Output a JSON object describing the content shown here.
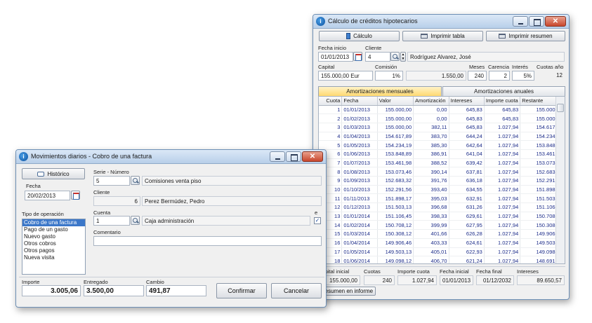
{
  "creditos": {
    "title": "Cálculo de créditos hipotecarios",
    "toolbar": {
      "calculo": "Cálculo",
      "imprimir_tabla": "Imprimir tabla",
      "imprimir_resumen": "Imprimir resumen"
    },
    "fecha_inicio": {
      "label": "Fecha inicio",
      "value": "01/01/2013"
    },
    "cliente": {
      "label": "Cliente",
      "code": "4",
      "name": "Rodríguez Alvarez, José"
    },
    "capital": {
      "label": "Capital",
      "value": "155.000,00 Eur"
    },
    "comision": {
      "label": "Comisión",
      "value": "1%",
      "amount": "1.550,00"
    },
    "meses": {
      "label": "Meses",
      "value": "240"
    },
    "carencia": {
      "label": "Carencia",
      "value": "2"
    },
    "interes": {
      "label": "Interés",
      "value": "5%"
    },
    "cuotas_anio": {
      "label": "Cuotas año",
      "value": "12"
    },
    "tabs": {
      "mensuales": "Amortizaciones mensuales",
      "anuales": "Amortizaciones anuales"
    },
    "table": {
      "headers": [
        "Cuota",
        "Fecha",
        "Valor",
        "Amortización",
        "Intereses",
        "Importe cuota",
        "Restante"
      ],
      "rows": [
        [
          "1",
          "01/01/2013",
          "155.000,00",
          "0,00",
          "645,83",
          "645,83",
          "155.000,00"
        ],
        [
          "2",
          "01/02/2013",
          "155.000,00",
          "0,00",
          "645,83",
          "645,83",
          "155.000,00"
        ],
        [
          "3",
          "01/03/2013",
          "155.000,00",
          "382,11",
          "645,83",
          "1.027,94",
          "154.617,89"
        ],
        [
          "4",
          "01/04/2013",
          "154.617,89",
          "383,70",
          "644,24",
          "1.027,94",
          "154.234,19"
        ],
        [
          "5",
          "01/05/2013",
          "154.234,19",
          "385,30",
          "642,64",
          "1.027,94",
          "153.848,89"
        ],
        [
          "6",
          "01/06/2013",
          "153.848,89",
          "386,91",
          "641,04",
          "1.027,94",
          "153.461,98"
        ],
        [
          "7",
          "01/07/2013",
          "153.461,98",
          "388,52",
          "639,42",
          "1.027,94",
          "153.073,46"
        ],
        [
          "8",
          "01/08/2013",
          "153.073,46",
          "390,14",
          "637,81",
          "1.027,94",
          "152.683,32"
        ],
        [
          "9",
          "01/09/2013",
          "152.683,32",
          "391,76",
          "636,18",
          "1.027,94",
          "152.291,56"
        ],
        [
          "10",
          "01/10/2013",
          "152.291,56",
          "393,40",
          "634,55",
          "1.027,94",
          "151.898,17"
        ],
        [
          "11",
          "01/11/2013",
          "151.898,17",
          "395,03",
          "632,91",
          "1.027,94",
          "151.503,13"
        ],
        [
          "12",
          "01/12/2013",
          "151.503,13",
          "396,68",
          "631,26",
          "1.027,94",
          "151.106,45"
        ],
        [
          "13",
          "01/01/2014",
          "151.106,45",
          "398,33",
          "629,61",
          "1.027,94",
          "150.708,12"
        ],
        [
          "14",
          "01/02/2014",
          "150.708,12",
          "399,99",
          "627,95",
          "1.027,94",
          "150.308,12"
        ],
        [
          "15",
          "01/03/2014",
          "150.308,12",
          "401,66",
          "626,28",
          "1.027,94",
          "149.906,46"
        ],
        [
          "16",
          "01/04/2014",
          "149.906,46",
          "403,33",
          "624,61",
          "1.027,94",
          "149.503,13"
        ],
        [
          "17",
          "01/05/2014",
          "149.503,13",
          "405,01",
          "622,93",
          "1.027,94",
          "149.098,12"
        ],
        [
          "18",
          "01/06/2014",
          "149.098,12",
          "406,70",
          "621,24",
          "1.027,94",
          "148.691,42"
        ]
      ]
    },
    "summary": {
      "labels": [
        "Capital inicial",
        "Cuotas",
        "Importe cuota",
        "Fecha inicial",
        "Fecha final",
        "Intereses"
      ],
      "values": [
        "155.000,00",
        "240",
        "1.027,94",
        "01/01/2013",
        "01/12/2032",
        "89.650,57"
      ]
    },
    "resumen_informe": "Resumen en informe"
  },
  "movimientos": {
    "title": "Movimientos diarios - Cobro de una factura",
    "historico": "Histórico",
    "fecha": {
      "label": "Fecha",
      "value": "20/02/2013"
    },
    "tipo_label": "Tipo de operación",
    "tipos": [
      "Cobro de una factura",
      "Pago de un gasto",
      "Nuevo gasto",
      "Otros cobros",
      "Otros pagos",
      "Nueva visita"
    ],
    "selected_tipo": 0,
    "serie": {
      "label": "Serie - Número",
      "value": "5",
      "desc": "Comisiones venta piso"
    },
    "cliente": {
      "label": "Cliente",
      "code": "6",
      "name": "Perez Bermúdez, Pedro"
    },
    "cuenta": {
      "label": "Cuenta",
      "value": "1",
      "desc": "Caja administración",
      "flag": "e"
    },
    "comentario": {
      "label": "Comentario",
      "value": ""
    },
    "importe": {
      "label": "Importe",
      "value": "3.005,06"
    },
    "entregado": {
      "label": "Entregado",
      "value": "3.500,00"
    },
    "cambio": {
      "label": "Cambio",
      "value": "491,87"
    },
    "confirmar": "Confirmar",
    "cancelar": "Cancelar"
  },
  "colors": {
    "selection": "#3b77c9",
    "grid_text": "#1d2d8a",
    "active_tab": "#ffd970",
    "close_button": "#c8472d"
  },
  "icons": [
    "app-icon",
    "calculator-icon",
    "printer-icon",
    "calendar-icon",
    "search-icon",
    "chat-icon"
  ]
}
